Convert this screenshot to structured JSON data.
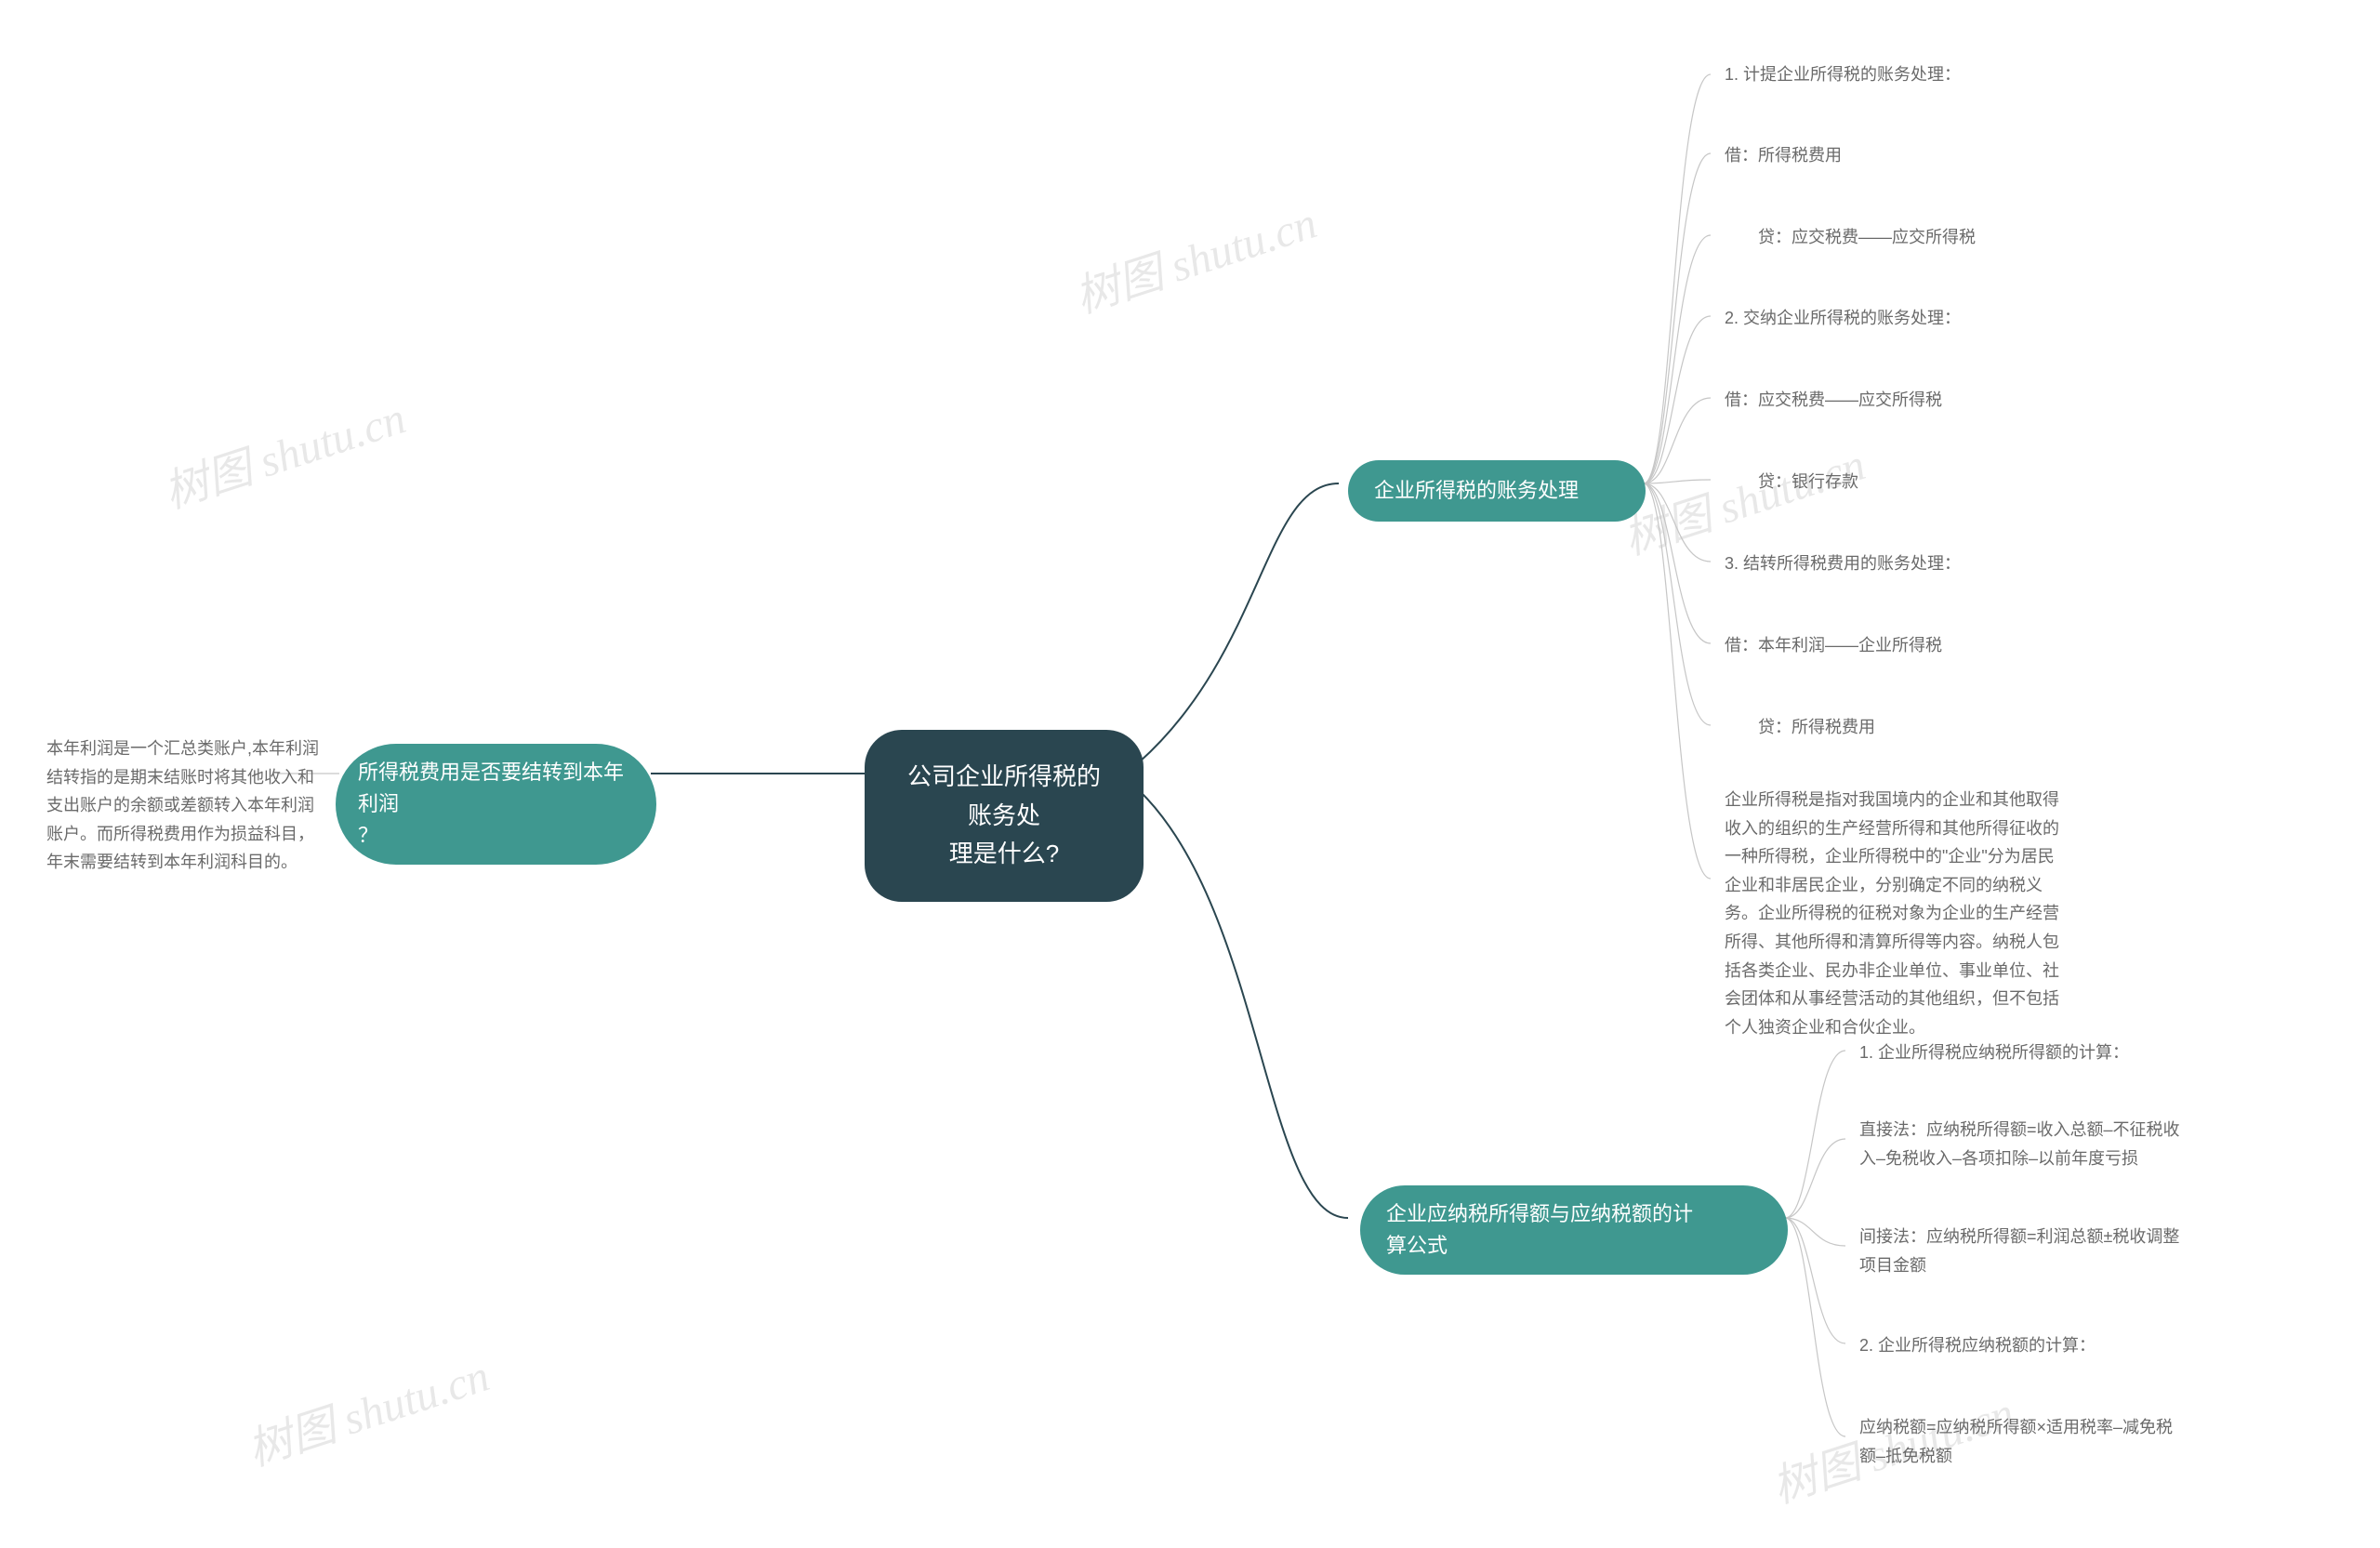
{
  "root": {
    "title_line1": "公司企业所得税的账务处",
    "title_line2": "理是什么?"
  },
  "left": {
    "branch_line1": "所得税费用是否要结转到本年利润",
    "branch_line2": "？",
    "leaf": "本年利润是一个汇总类账户,本年利润结转指的是期末结账时将其他收入和支出账户的余额或差额转入本年利润账户。而所得税费用作为损益科目，年末需要结转到本年利润科目的。"
  },
  "right1": {
    "branch": "企业所得税的账务处理",
    "items": [
      "1. 计提企业所得税的账务处理：",
      "借：所得税费用",
      "　　贷：应交税费——应交所得税",
      "2. 交纳企业所得税的账务处理：",
      "借：应交税费——应交所得税",
      "　　贷：银行存款",
      "3. 结转所得税费用的账务处理：",
      "借：本年利润——企业所得税",
      "　　贷：所得税费用"
    ],
    "para": "企业所得税是指对我国境内的企业和其他取得收入的组织的生产经营所得和其他所得征收的一种所得税，企业所得税中的\"企业\"分为居民企业和非居民企业，分别确定不同的纳税义务。企业所得税的征税对象为企业的生产经营所得、其他所得和清算所得等内容。纳税人包括各类企业、民办非企业单位、事业单位、社会团体和从事经营活动的其他组织，但不包括个人独资企业和合伙企业。"
  },
  "right2": {
    "branch_line1": "企业应纳税所得额与应纳税额的计",
    "branch_line2": "算公式",
    "items": [
      "1. 企业所得税应纳税所得额的计算：",
      "直接法：应纳税所得额=收入总额–不征税收入–免税收入–各项扣除–以前年度亏损",
      "间接法：应纳税所得额=利润总额±税收调整项目金额",
      "2. 企业所得税应纳税额的计算：",
      "应纳税额=应纳税所得额×适用税率–减免税额–抵免税额"
    ]
  },
  "watermark": "树图 shutu.cn",
  "colors": {
    "root_bg": "#2a4650",
    "branch_bg": "#3f9890",
    "leaf_fg": "#6a6a6a"
  }
}
